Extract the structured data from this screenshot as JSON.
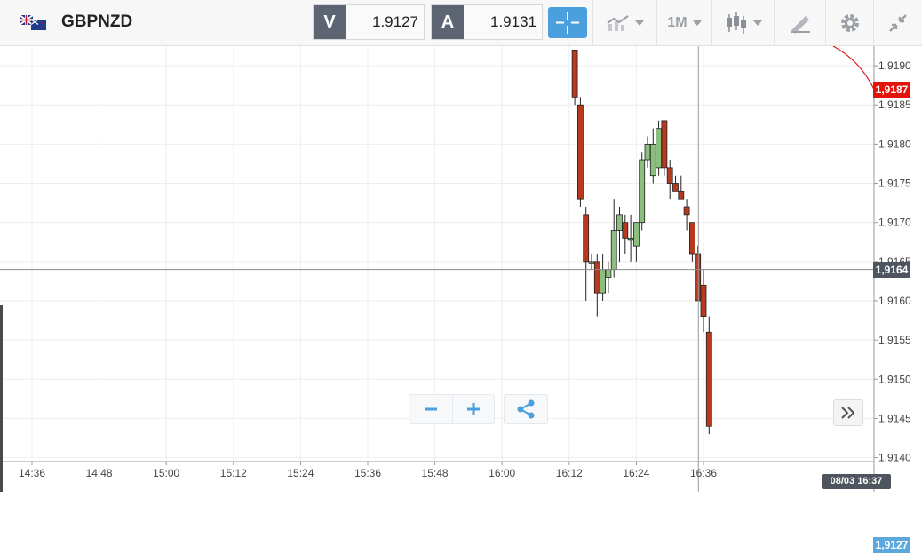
{
  "header": {
    "symbol": "GBPNZD",
    "bid": {
      "letter": "V",
      "value": "1.9127"
    },
    "ask": {
      "letter": "A",
      "value": "1.9131"
    },
    "timeframe_label": "1M"
  },
  "chart": {
    "y_ticks": [
      "1,9190",
      "1,9185",
      "1,9180",
      "1,9175",
      "1,9170",
      "1,9165",
      "1,9160",
      "1,9155",
      "1,9150",
      "1,9145",
      "1,9140"
    ],
    "x_ticks": [
      "14:36",
      "14:48",
      "15:00",
      "15:12",
      "15:24",
      "15:36",
      "15:48",
      "16:00",
      "16:12",
      "16:24",
      "16:36"
    ],
    "price_red_label": "1,9187",
    "crosshair_price_label": "1,9164",
    "last_price_label": "1,9127",
    "crosshair_time_label": "08/03 16:37",
    "colors": {
      "up": "#8cbf7e",
      "down": "#b73a1f",
      "indicator": "#d42020",
      "accent": "#4a9fdc"
    }
  },
  "chart_data": {
    "type": "candlestick",
    "x_range": [
      "14:36",
      "16:37"
    ],
    "ylim": [
      1.91395,
      1.91925
    ],
    "candles": [
      {
        "t": "16:13",
        "o": 1.9192,
        "h": 1.9192,
        "l": 1.9185,
        "c": 1.9186
      },
      {
        "t": "16:14",
        "o": 1.9185,
        "h": 1.9186,
        "l": 1.9172,
        "c": 1.9173
      },
      {
        "t": "16:15",
        "o": 1.9171,
        "h": 1.9172,
        "l": 1.916,
        "c": 1.9165
      },
      {
        "t": "16:16",
        "o": 1.9165,
        "h": 1.9166,
        "l": 1.9164,
        "c": 1.9165
      },
      {
        "t": "16:17",
        "o": 1.9165,
        "h": 1.9166,
        "l": 1.9158,
        "c": 1.9161
      },
      {
        "t": "16:18",
        "o": 1.9161,
        "h": 1.9166,
        "l": 1.916,
        "c": 1.9164
      },
      {
        "t": "16:19",
        "o": 1.9163,
        "h": 1.9165,
        "l": 1.9161,
        "c": 1.9164
      },
      {
        "t": "16:20",
        "o": 1.9164,
        "h": 1.9173,
        "l": 1.9163,
        "c": 1.9169
      },
      {
        "t": "16:21",
        "o": 1.9169,
        "h": 1.9172,
        "l": 1.9165,
        "c": 1.9171
      },
      {
        "t": "16:22",
        "o": 1.917,
        "h": 1.9171,
        "l": 1.9166,
        "c": 1.9168
      },
      {
        "t": "16:23",
        "o": 1.9168,
        "h": 1.9171,
        "l": 1.9165,
        "c": 1.9168
      },
      {
        "t": "16:24",
        "o": 1.9167,
        "h": 1.917,
        "l": 1.9165,
        "c": 1.917
      },
      {
        "t": "16:25",
        "o": 1.917,
        "h": 1.9179,
        "l": 1.9169,
        "c": 1.9178
      },
      {
        "t": "16:26",
        "o": 1.9178,
        "h": 1.9181,
        "l": 1.9177,
        "c": 1.918
      },
      {
        "t": "16:27",
        "o": 1.9176,
        "h": 1.9182,
        "l": 1.9175,
        "c": 1.918
      },
      {
        "t": "16:28",
        "o": 1.9177,
        "h": 1.9183,
        "l": 1.9176,
        "c": 1.9182
      },
      {
        "t": "16:29",
        "o": 1.9183,
        "h": 1.9183,
        "l": 1.9176,
        "c": 1.9177
      },
      {
        "t": "16:30",
        "o": 1.9177,
        "h": 1.9178,
        "l": 1.9173,
        "c": 1.9175
      },
      {
        "t": "16:31",
        "o": 1.9175,
        "h": 1.9176,
        "l": 1.9174,
        "c": 1.9174
      },
      {
        "t": "16:32",
        "o": 1.9174,
        "h": 1.9176,
        "l": 1.9173,
        "c": 1.9173
      },
      {
        "t": "16:33",
        "o": 1.9172,
        "h": 1.9173,
        "l": 1.9169,
        "c": 1.9171
      },
      {
        "t": "16:34",
        "o": 1.917,
        "h": 1.917,
        "l": 1.9165,
        "c": 1.9166
      },
      {
        "t": "16:35",
        "o": 1.9166,
        "h": 1.9167,
        "l": 1.916,
        "c": 1.916
      },
      {
        "t": "16:36",
        "o": 1.9162,
        "h": 1.9164,
        "l": 1.9156,
        "c": 1.9158
      },
      {
        "t": "16:37",
        "o": 1.9156,
        "h": 1.9158,
        "l": 1.9143,
        "c": 1.9144
      }
    ],
    "crosshair": {
      "price": 1.9164,
      "time": "16:37"
    }
  }
}
